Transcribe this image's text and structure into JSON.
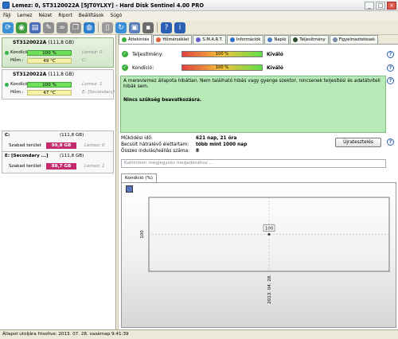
{
  "window": {
    "title": "Lemez: 0, ST3120022A [5JT0YLXY]  -  Hard Disk Sentinel 4.00 PRO"
  },
  "menu": [
    "Fájl",
    "Lemez",
    "Nézet",
    "Riport",
    "Beállítások",
    "Súgó"
  ],
  "toolbar": {
    "icons": [
      "refresh-icon",
      "globe-icon",
      "report-icon",
      "dropper-icon",
      "link-icon",
      "copy-icon",
      "world-icon",
      "device-icon",
      "refresh2-icon",
      "device2-icon",
      "floppy-icon",
      "help-icon",
      "info-icon"
    ]
  },
  "disks": [
    {
      "name": "ST3120022A",
      "size": "(111,8 GB)",
      "condition_label": "Kondíció:",
      "condition": "100 %",
      "disk_label": "Lemez: 0",
      "temp_label": "Hőm.:",
      "temp": "49 °C",
      "drive": "C:"
    },
    {
      "name": "ST3120022A",
      "size": "(111,8 GB)",
      "condition_label": "Kondíció:",
      "condition": "100 %",
      "disk_label": "Lemez: 1",
      "temp_label": "Hőm.:",
      "temp": "47 °C",
      "drive": "E: [Secondary]"
    }
  ],
  "volumes": [
    {
      "name": "C:",
      "size": "(111,8 GB)",
      "free_label": "Szabad terület",
      "free": "99,8 GB",
      "disk_label": "Lemez: 0"
    },
    {
      "name": "E: [Secondary ...]",
      "size": "(111,8 GB)",
      "free_label": "Szabad terület",
      "free": "88,7 GB",
      "disk_label": "Lemez: 1"
    }
  ],
  "tabs": [
    "Áttekintés",
    "Hőmérséklet",
    "S.M.A.R.T.",
    "Információk",
    "Napló",
    "Teljesítmény",
    "Figyelmeztetések"
  ],
  "overview": {
    "performance_label": "Teljesítmény:",
    "performance": "100 %",
    "performance_state": "Kiváló",
    "health_label": "Kondíció:",
    "health": "100 %",
    "health_state": "Kiváló",
    "message": "A merevlemez állapota hibátlan. Nem található hibás vagy gyenge szektor, nincsenek teljesítési és adatátviteli hibák sem.",
    "action": "Nincs szükség beavatkozásra.",
    "uptime_label": "Működési idő:",
    "uptime": "621 nap, 21 óra",
    "lifetime_label": "Becsült hátralévő élettartam:",
    "lifetime": "több mint 1000 nap",
    "starts_label": "Összes indulás/leállás száma:",
    "starts": "8",
    "report_button": "Újratesztelés",
    "comment_placeholder": "Kattintson megjegyzés megadásához ...",
    "chart_tab": "Kondíció (%)"
  },
  "chart_data": {
    "type": "line",
    "title": "",
    "xlabel": "",
    "ylabel": "",
    "x": [
      "2013. 04. 28."
    ],
    "series": [
      {
        "values": [
          100
        ]
      }
    ],
    "point_label": "100",
    "y_tick_label": "100"
  },
  "status": "Állapot utoljára frissítve: 2013. 07. 28. vasárnap 9:41:39"
}
